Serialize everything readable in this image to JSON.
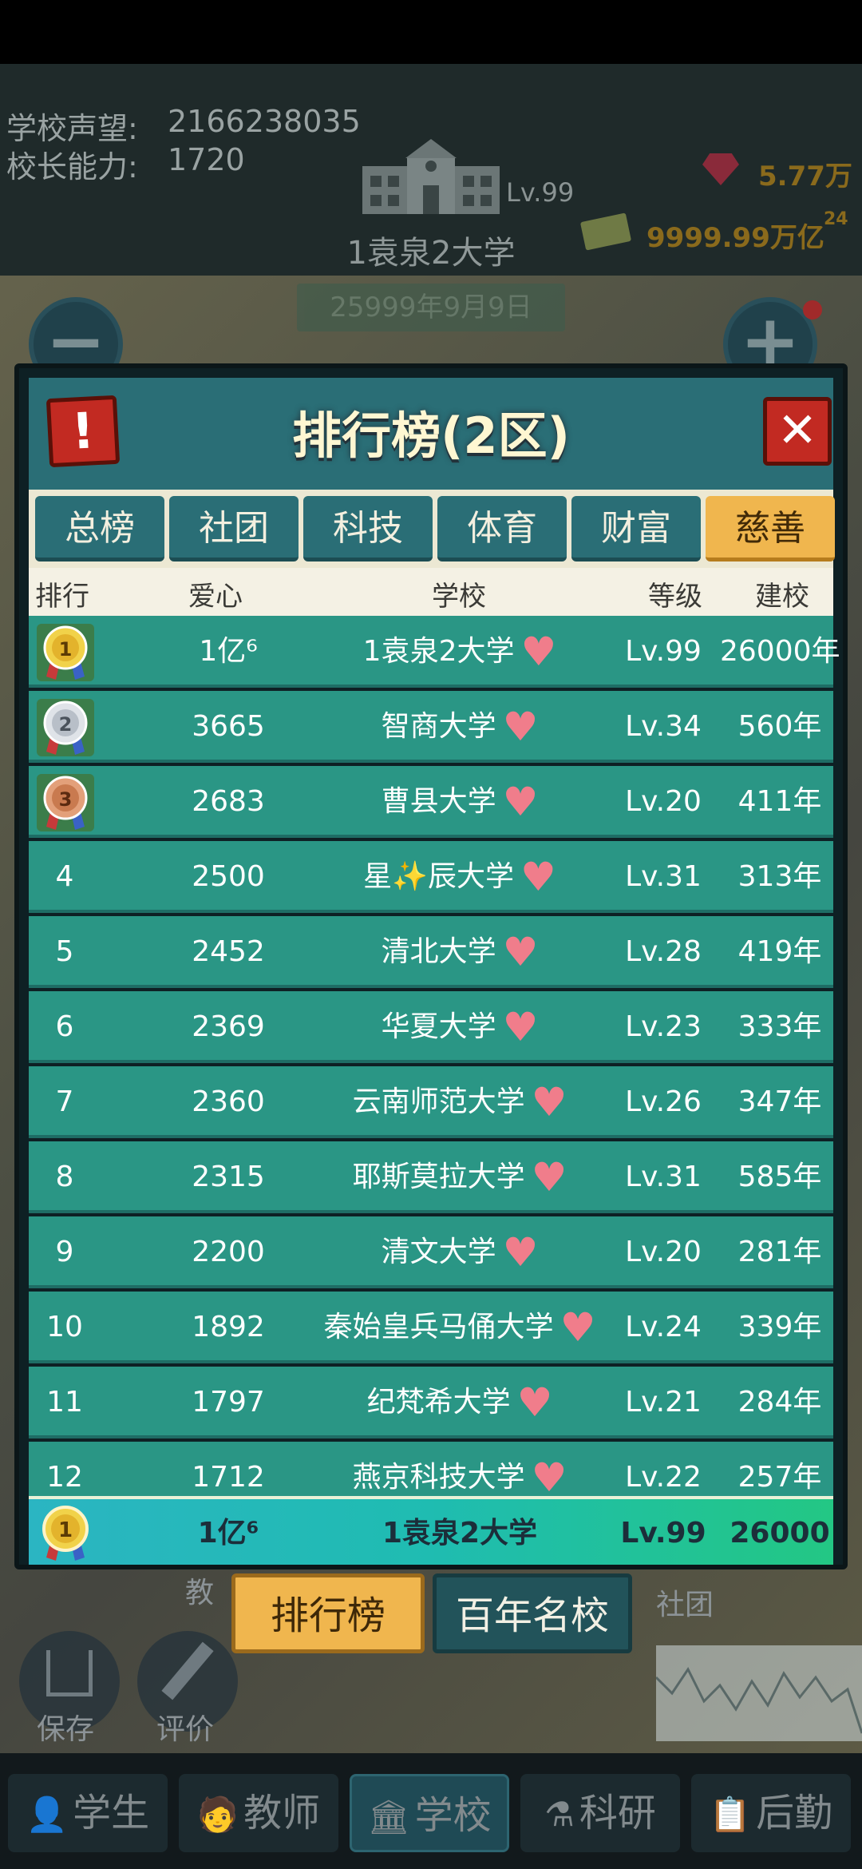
{
  "header": {
    "prestige_label": "学校声望:",
    "prestige_value": "2166238035",
    "principal_label": "校长能力:",
    "principal_value": "1720",
    "school_level": "Lv.99",
    "school_name": "1袁泉2大学",
    "date": "25999年9月9日",
    "gems": "5.77万",
    "money": "9999.99万亿",
    "money_exp": "24"
  },
  "modal": {
    "title": "排行榜(2区)",
    "alert_symbol": "!",
    "close_symbol": "✕",
    "tabs": [
      {
        "label": "总榜",
        "active": false
      },
      {
        "label": "社团",
        "active": false
      },
      {
        "label": "科技",
        "active": false
      },
      {
        "label": "体育",
        "active": false
      },
      {
        "label": "财富",
        "active": false
      },
      {
        "label": "慈善",
        "active": true
      }
    ],
    "columns": {
      "rank": "排行",
      "love": "爱心",
      "school": "学校",
      "level": "等级",
      "founded": "建校"
    },
    "rows": [
      {
        "rank": "1",
        "medal": "gold",
        "love": "1亿⁶",
        "school": "1袁泉2大学",
        "level": "Lv.99",
        "founded": "26000年"
      },
      {
        "rank": "2",
        "medal": "silver",
        "love": "3665",
        "school": "智商大学",
        "level": "Lv.34",
        "founded": "560年"
      },
      {
        "rank": "3",
        "medal": "bronze",
        "love": "2683",
        "school": "曹县大学",
        "level": "Lv.20",
        "founded": "411年"
      },
      {
        "rank": "4",
        "love": "2500",
        "school": "星✨辰大学",
        "level": "Lv.31",
        "founded": "313年"
      },
      {
        "rank": "5",
        "love": "2452",
        "school": "清北大学",
        "level": "Lv.28",
        "founded": "419年"
      },
      {
        "rank": "6",
        "love": "2369",
        "school": "华夏大学",
        "level": "Lv.23",
        "founded": "333年"
      },
      {
        "rank": "7",
        "love": "2360",
        "school": "云南师范大学",
        "level": "Lv.26",
        "founded": "347年"
      },
      {
        "rank": "8",
        "love": "2315",
        "school": "耶斯莫拉大学",
        "level": "Lv.31",
        "founded": "585年"
      },
      {
        "rank": "9",
        "love": "2200",
        "school": "清文大学",
        "level": "Lv.20",
        "founded": "281年"
      },
      {
        "rank": "10",
        "love": "1892",
        "school": "秦始皇兵马俑大学",
        "level": "Lv.24",
        "founded": "339年"
      },
      {
        "rank": "11",
        "love": "1797",
        "school": "纪梵希大学",
        "level": "Lv.21",
        "founded": "284年"
      },
      {
        "rank": "12",
        "love": "1712",
        "school": "燕京科技大学",
        "level": "Lv.22",
        "founded": "257年"
      }
    ],
    "my_row": {
      "rank": "1",
      "love": "1亿⁶",
      "school": "1袁泉2大学",
      "level": "Lv.99",
      "founded": "26000"
    }
  },
  "bottom_tabs": {
    "ranking": "排行榜",
    "century": "百年名校"
  },
  "background_labels": {
    "teach": "教",
    "club": "社团",
    "save": "保存",
    "rate": "评价"
  },
  "nav": [
    {
      "label": "学生",
      "icon": "student-icon",
      "active": false
    },
    {
      "label": "教师",
      "icon": "teacher-icon",
      "active": false
    },
    {
      "label": "学校",
      "icon": "school-icon",
      "active": true
    },
    {
      "label": "科研",
      "icon": "research-icon",
      "active": false
    },
    {
      "label": "后勤",
      "icon": "logistics-icon",
      "active": false
    }
  ],
  "colors": {
    "row_bg": "#2a9685",
    "active_tab": "#f0b64e",
    "heart": "#f07d8b",
    "close_red": "#c22a22"
  }
}
